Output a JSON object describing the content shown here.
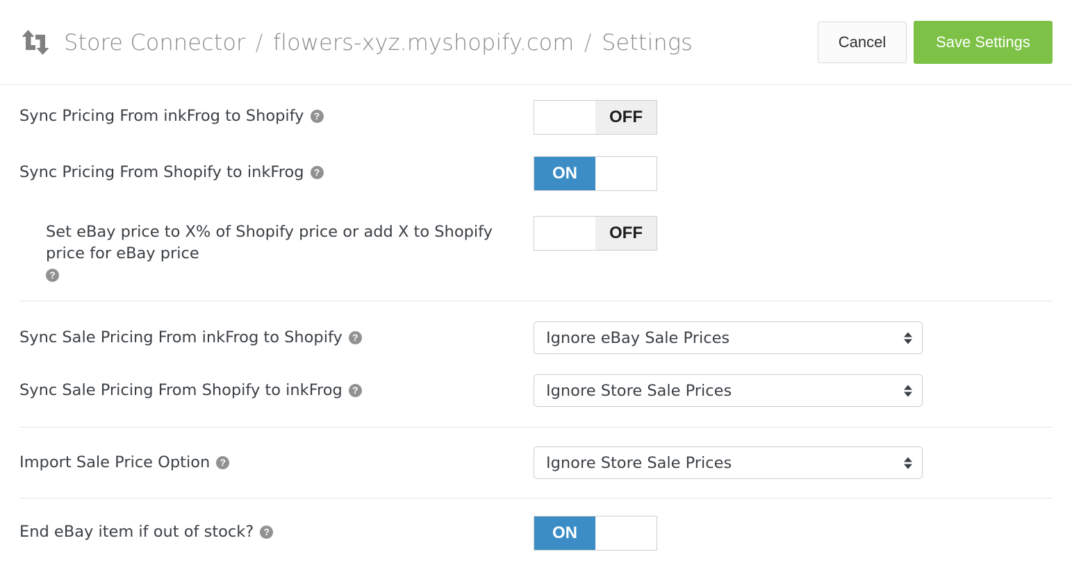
{
  "header": {
    "icon": "sync-arrows-icon",
    "breadcrumb": {
      "app": "Store Connector",
      "sep1": "/",
      "store": "flowers-xyz.myshopify.com",
      "sep2": "/",
      "page": "Settings"
    },
    "cancel_label": "Cancel",
    "save_label": "Save Settings",
    "save_color": "#7dc246"
  },
  "help_icon_glyph": "?",
  "toggle_on_label": "ON",
  "toggle_off_label": "OFF",
  "toggle_on_color": "#3c8dc5",
  "toggle_off_color": "#efefef",
  "settings": {
    "sync_pricing_inkfrog_to_shopify": {
      "label": "Sync Pricing From inkFrog to Shopify",
      "value": "OFF"
    },
    "sync_pricing_shopify_to_inkfrog": {
      "label": "Sync Pricing From Shopify to inkFrog",
      "value": "ON"
    },
    "ebay_price_formula": {
      "label": "Set eBay price to X% of Shopify price or add X to Shopify price for eBay price",
      "value": "OFF"
    },
    "sync_sale_pricing_inkfrog_to_shopify": {
      "label": "Sync Sale Pricing From inkFrog to Shopify",
      "value": "Ignore eBay Sale Prices"
    },
    "sync_sale_pricing_shopify_to_inkfrog": {
      "label": "Sync Sale Pricing From Shopify to inkFrog",
      "value": "Ignore Store Sale Prices"
    },
    "import_sale_price_option": {
      "label": "Import Sale Price Option",
      "value": "Ignore Store Sale Prices"
    },
    "end_ebay_item_if_out_of_stock": {
      "label": "End eBay item if out of stock?",
      "value": "ON"
    }
  }
}
